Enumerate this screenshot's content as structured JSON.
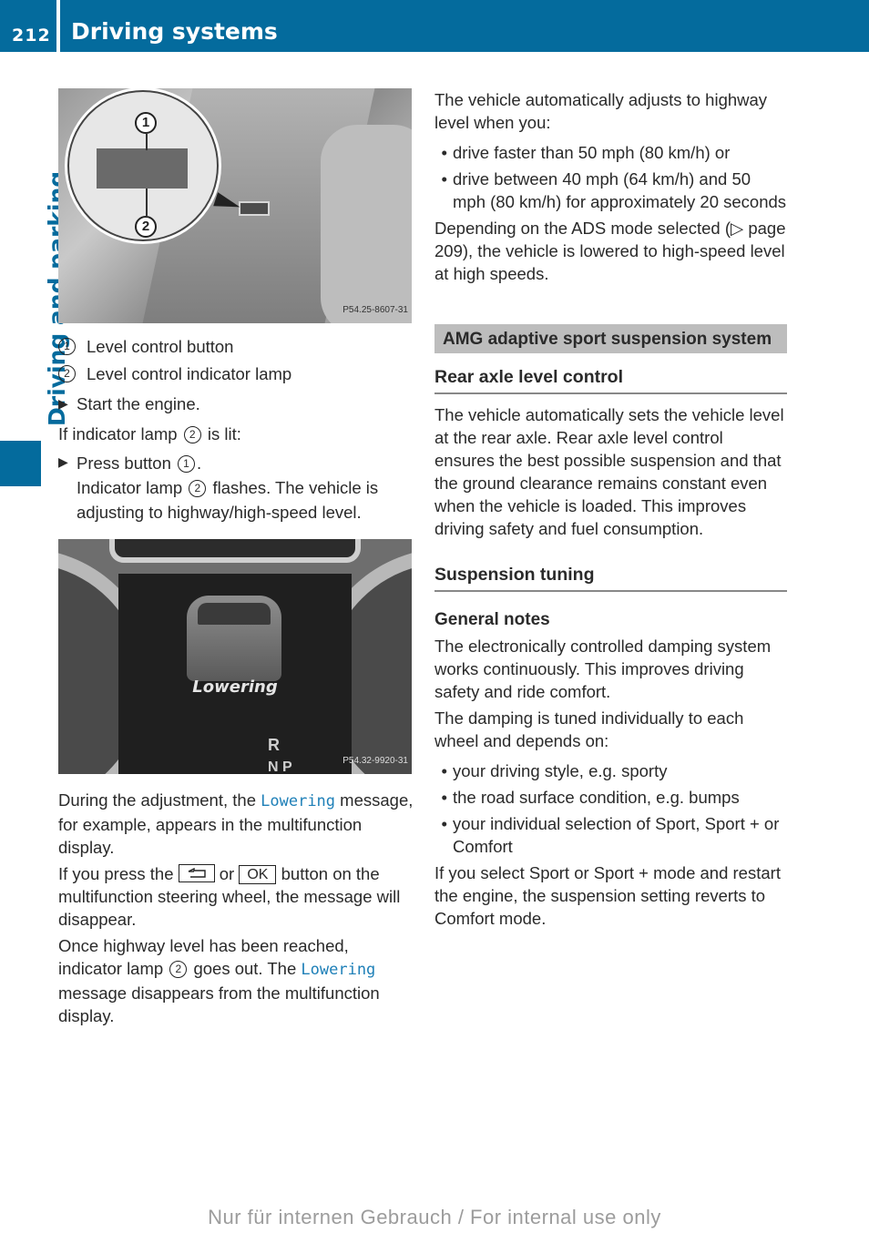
{
  "header": {
    "page_number": "212",
    "section_title": "Driving systems",
    "accent_color": "#046b9d"
  },
  "side_tab": {
    "label": "Driving and parking"
  },
  "left_column": {
    "figure1": {
      "alt": "Center console with level control button and indicator lamp",
      "callout_1": "1",
      "callout_2": "2",
      "code": "P54.25-8607-31"
    },
    "legend": [
      {
        "num": "1",
        "text": "Level control button"
      },
      {
        "num": "2",
        "text": "Level control indicator lamp"
      }
    ],
    "step1": "Start the engine.",
    "condition": {
      "before": "If indicator lamp",
      "num": "2",
      "after": "is lit:"
    },
    "step2": {
      "before": "Press button",
      "num": "1",
      "after": ".",
      "result_before": "Indicator lamp",
      "result_num": "2",
      "result_after": "flashes. The vehicle is adjusting to highway/high-speed level."
    },
    "figure2": {
      "alt": "Instrument cluster multifunction display showing Lowering message",
      "display_message": "Lowering",
      "gear_r": "R",
      "gear_np": "N P",
      "code": "P54.32-9920-31"
    },
    "para1": {
      "before": "During the adjustment, the",
      "highlight": "Lowering",
      "after": "message, for example, appears in the multifunction display."
    },
    "para2": {
      "before": "If you press the",
      "key_back": "back-icon",
      "or": "or",
      "key_ok": "OK",
      "after": "button on the multifunction steering wheel, the message will disappear."
    },
    "para3": {
      "before": "Once highway level has been reached, indicator lamp",
      "num": "2",
      "mid": "goes out. The",
      "highlight": "Lowering",
      "after": "message disappears from the multifunction display."
    }
  },
  "right_column": {
    "intro": "The vehicle automatically adjusts to highway level when you:",
    "intro_bullets": [
      "drive faster than 50 mph (80 km/h) or",
      "drive between 40 mph (64 km/h) and 50 mph (80 km/h) for approximately 20 seconds"
    ],
    "ads_para": "Depending on the ADS mode selected (▷ page 209), the vehicle is lowered to high-speed level at high speeds.",
    "section_title": "AMG adaptive sport suspension system",
    "rear_axle": {
      "heading": "Rear axle level control",
      "text": "The vehicle automatically sets the vehicle level at the rear axle. Rear axle level control ensures the best possible suspension and that the ground clearance remains constant even when the vehicle is loaded. This improves driving safety and fuel consumption."
    },
    "suspension_tuning": {
      "heading": "Suspension tuning",
      "subheading": "General notes",
      "para1": "The electronically controlled damping system works continuously. This improves driving safety and ride comfort.",
      "para2": "The damping is tuned individually to each wheel and depends on:",
      "bullets": [
        "your driving style, e.g. sporty",
        "the road surface condition, e.g. bumps",
        "your individual selection of Sport, Sport + or Comfort"
      ],
      "para3": "If you select Sport or Sport + mode and restart the engine, the suspension setting reverts to Comfort mode."
    }
  },
  "footer": {
    "watermark": "Nur für internen Gebrauch / For internal use only"
  }
}
